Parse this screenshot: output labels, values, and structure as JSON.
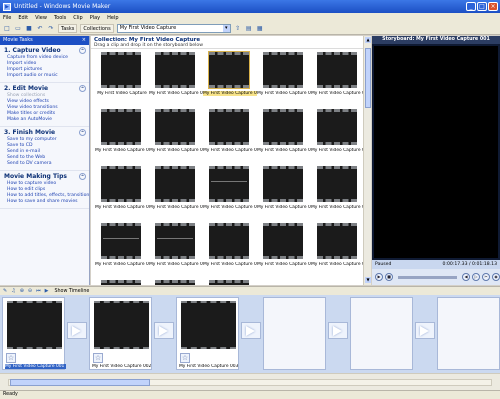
{
  "window": {
    "title": "Untitled - Windows Movie Maker"
  },
  "menu": [
    "File",
    "Edit",
    "View",
    "Tools",
    "Clip",
    "Play",
    "Help"
  ],
  "toolbar": {
    "tasks_label": "Tasks",
    "collections_label": "Collections",
    "collection_value": "My First Video Capture"
  },
  "tasks_pane": {
    "header": "Movie Tasks",
    "sections": [
      {
        "title": "1. Capture Video",
        "links": [
          "Capture from video device",
          "Import video",
          "Import pictures",
          "Import audio or music"
        ]
      },
      {
        "title": "2. Edit Movie",
        "links": [
          "Show collections",
          "View video effects",
          "View video transitions",
          "Make titles or credits",
          "Make an AutoMovie"
        ]
      },
      {
        "title": "3. Finish Movie",
        "links": [
          "Save to my computer",
          "Save to CD",
          "Send in e-mail",
          "Send to the Web",
          "Send to DV camera"
        ]
      },
      {
        "title": "Movie Making Tips",
        "links": [
          "How to capture video",
          "How to edit clips",
          "How to add titles, effects, transitions",
          "How to save and share movies"
        ]
      }
    ]
  },
  "collection": {
    "title": "Collection: My First Video Capture",
    "subtitle": "Drag a clip and drop it on the storyboard below",
    "clips": [
      "My First Video Capture",
      "My First Video Capture 002",
      "My First Video Capture 003",
      "My First Video Capture 004",
      "My First Video Capture 005",
      "My First Video Capture 006",
      "My First Video Capture 007",
      "My First Video Capture 008",
      "My First Video Capture 009",
      "My First Video Capture 010",
      "My First Video Capture 011",
      "My First Video Capture 012",
      "My First Video Capture 013",
      "My First Video Capture 014",
      "My First Video Capture 015",
      "My First Video Capture 016",
      "My First Video Capture 017",
      "My First Video Capture 018",
      "My First Video Capture 019",
      "My First Video Capture 020",
      "",
      "",
      ""
    ]
  },
  "preview": {
    "title": "Storyboard: My First Video Capture 001",
    "status": "Paused",
    "time": "0:00:17.33 / 0:01:18.13"
  },
  "storyboard": {
    "show_timeline_label": "Show Timeline",
    "items": [
      "My First Video Capture 001",
      "My First Video Capture 002",
      "My First Video Capture 003"
    ]
  },
  "statusbar": {
    "text": "Ready"
  }
}
